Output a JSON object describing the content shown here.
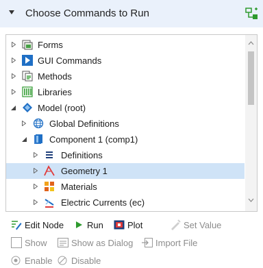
{
  "panel": {
    "title": "Choose Commands to Run",
    "tree": [
      {
        "label": "Forms",
        "icon": "forms-icon",
        "expander": "closed"
      },
      {
        "label": "GUI Commands",
        "icon": "gui-commands-icon",
        "expander": "closed"
      },
      {
        "label": "Methods",
        "icon": "methods-icon",
        "expander": "closed"
      },
      {
        "label": "Libraries",
        "icon": "libraries-icon",
        "expander": "closed"
      },
      {
        "label": "Model (root)",
        "icon": "model-root-icon",
        "expander": "open"
      },
      {
        "label": "Global Definitions",
        "icon": "global-definitions-icon",
        "expander": "closed"
      },
      {
        "label": "Component 1 (comp1)",
        "icon": "component-icon",
        "expander": "open"
      },
      {
        "label": "Definitions",
        "icon": "definitions-icon",
        "expander": "closed"
      },
      {
        "label": "Geometry 1",
        "icon": "geometry-icon",
        "expander": "closed",
        "selected": true
      },
      {
        "label": "Materials",
        "icon": "materials-icon",
        "expander": "closed"
      },
      {
        "label": "Electric Currents (ec)",
        "icon": "electric-currents-icon",
        "expander": "closed"
      }
    ],
    "toolbar": {
      "edit_node": "Edit Node",
      "run": "Run",
      "plot": "Plot",
      "set_value": "Set Value",
      "show": "Show",
      "show_as_dialog": "Show as Dialog",
      "import_file": "Import File",
      "enable": "Enable",
      "disable": "Disable"
    },
    "colors": {
      "header_bg": "#eaf1fb",
      "selection": "#cfe3f7",
      "accent_blue": "#1f6fc5",
      "green": "#2e9a2e"
    }
  }
}
